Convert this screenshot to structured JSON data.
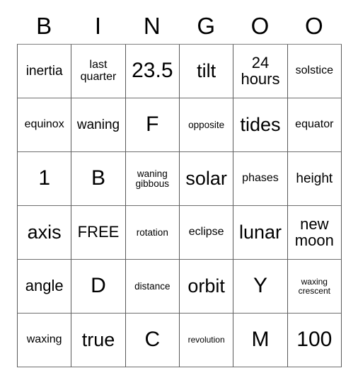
{
  "card": {
    "title_letters": [
      "B",
      "I",
      "N",
      "G",
      "O",
      "O"
    ],
    "columns": 6,
    "rows": 6,
    "grid": [
      [
        {
          "text": "inertia",
          "size": "md"
        },
        {
          "text": "last quarter",
          "size": "sm"
        },
        {
          "text": "23.5",
          "size": "xxl"
        },
        {
          "text": "tilt",
          "size": "xl"
        },
        {
          "text": "24 hours",
          "size": "lg"
        },
        {
          "text": "solstice",
          "size": "sm"
        }
      ],
      [
        {
          "text": "equinox",
          "size": "sm"
        },
        {
          "text": "waning",
          "size": "md"
        },
        {
          "text": "F",
          "size": "xxl"
        },
        {
          "text": "opposite",
          "size": "xs"
        },
        {
          "text": "tides",
          "size": "xl"
        },
        {
          "text": "equator",
          "size": "sm"
        }
      ],
      [
        {
          "text": "1",
          "size": "xxl"
        },
        {
          "text": "B",
          "size": "xxl"
        },
        {
          "text": "waning gibbous",
          "size": "xs"
        },
        {
          "text": "solar",
          "size": "xl"
        },
        {
          "text": "phases",
          "size": "sm"
        },
        {
          "text": "height",
          "size": "md"
        }
      ],
      [
        {
          "text": "axis",
          "size": "xl"
        },
        {
          "text": "FREE",
          "size": "lg"
        },
        {
          "text": "rotation",
          "size": "xs"
        },
        {
          "text": "eclipse",
          "size": "sm"
        },
        {
          "text": "lunar",
          "size": "xl"
        },
        {
          "text": "new moon",
          "size": "lg"
        }
      ],
      [
        {
          "text": "angle",
          "size": "lg"
        },
        {
          "text": "D",
          "size": "xxl"
        },
        {
          "text": "distance",
          "size": "xs"
        },
        {
          "text": "orbit",
          "size": "xl"
        },
        {
          "text": "Y",
          "size": "xxl"
        },
        {
          "text": "waxing crescent",
          "size": "xxs"
        }
      ],
      [
        {
          "text": "waxing",
          "size": "sm"
        },
        {
          "text": "true",
          "size": "xl"
        },
        {
          "text": "C",
          "size": "xxl"
        },
        {
          "text": "revolution",
          "size": "xxs"
        },
        {
          "text": "M",
          "size": "xxl"
        },
        {
          "text": "100",
          "size": "xxl"
        }
      ]
    ],
    "colors": {
      "background": "#ffffff",
      "text": "#000000",
      "grid_line": "#5a5a5a"
    }
  }
}
